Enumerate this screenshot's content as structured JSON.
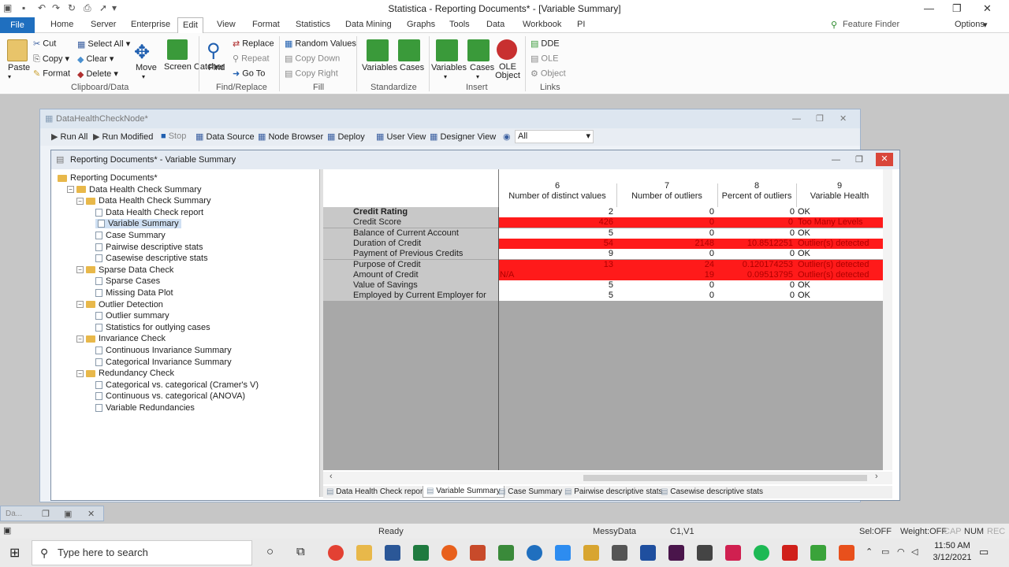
{
  "app_title": "Statistica - Reporting Documents* - [Variable Summary]",
  "menu": {
    "file": "File",
    "items": [
      "Home",
      "Server",
      "Enterprise",
      "Edit",
      "View",
      "Format",
      "Statistics",
      "Data Mining",
      "Graphs",
      "Tools",
      "Data",
      "Workbook",
      "PI"
    ],
    "feature_finder": "Feature Finder",
    "options": "Options"
  },
  "ribbon": {
    "paste": "Paste",
    "cut": "Cut",
    "copy": "Copy",
    "format": "Format",
    "select_all": "Select All",
    "clear": "Clear",
    "delete": "Delete",
    "move": "Move",
    "screen_catcher": "Screen Catcher",
    "find": "Find",
    "replace": "Replace",
    "repeat": "Repeat",
    "go_to": "Go To",
    "random_values": "Random Values",
    "copy_down": "Copy Down",
    "copy_right": "Copy Right",
    "std_variables": "Variables",
    "std_cases": "Cases",
    "ins_variables": "Variables",
    "ins_cases": "Cases",
    "ole_object": "OLE Object",
    "dde": "DDE",
    "ole": "OLE",
    "object": "Object",
    "groups": [
      "Clipboard/Data",
      "Find/Replace",
      "Fill",
      "Standardize",
      "Insert",
      "Links"
    ]
  },
  "node_window": {
    "title": "DataHealthCheckNode*",
    "toolbar": [
      "Run All",
      "Run Modified",
      "Stop",
      "Data Source",
      "Node Browser",
      "Deploy",
      "User View",
      "Designer View"
    ],
    "filter_value": "All"
  },
  "report_window": {
    "title": "Reporting Documents* - Variable Summary",
    "tree": [
      {
        "label": "Reporting Documents*",
        "level": 0,
        "type": "folder"
      },
      {
        "label": "Data Health Check Summary",
        "level": 1,
        "type": "folder"
      },
      {
        "label": "Data Health Check Summary",
        "level": 2,
        "type": "folder"
      },
      {
        "label": "Data Health Check report",
        "level": 3,
        "type": "doc"
      },
      {
        "label": "Variable Summary",
        "level": 3,
        "type": "doc",
        "selected": true
      },
      {
        "label": "Case Summary",
        "level": 3,
        "type": "doc"
      },
      {
        "label": "Pairwise descriptive stats",
        "level": 3,
        "type": "doc"
      },
      {
        "label": "Casewise descriptive stats",
        "level": 3,
        "type": "doc"
      },
      {
        "label": "Sparse Data Check",
        "level": 2,
        "type": "folder"
      },
      {
        "label": "Sparse Cases",
        "level": 3,
        "type": "doc"
      },
      {
        "label": "Missing Data Plot",
        "level": 3,
        "type": "doc"
      },
      {
        "label": "Outlier Detection",
        "level": 2,
        "type": "folder"
      },
      {
        "label": "Outlier summary",
        "level": 3,
        "type": "doc"
      },
      {
        "label": "Statistics for outlying cases",
        "level": 3,
        "type": "doc"
      },
      {
        "label": "Invariance Check",
        "level": 2,
        "type": "folder"
      },
      {
        "label": "Continuous Invariance Summary",
        "level": 3,
        "type": "doc"
      },
      {
        "label": "Categorical Invariance Summary",
        "level": 3,
        "type": "doc"
      },
      {
        "label": "Redundancy Check",
        "level": 2,
        "type": "folder"
      },
      {
        "label": "Categorical vs. categorical (Cramer's V)",
        "level": 3,
        "type": "doc"
      },
      {
        "label": "Continuous vs. categorical (ANOVA)",
        "level": 3,
        "type": "doc"
      },
      {
        "label": "Variable Redundancies",
        "level": 3,
        "type": "doc"
      }
    ],
    "columns": [
      {
        "num": "6",
        "name": "Number of distinct values"
      },
      {
        "num": "7",
        "name": "Number of outliers"
      },
      {
        "num": "8",
        "name": "Percent of outliers"
      },
      {
        "num": "9",
        "name": "Variable Health"
      }
    ],
    "rows": [
      {
        "label": "Credit Rating",
        "bold": true,
        "values": [
          "2",
          "0",
          "0",
          "OK"
        ],
        "flag": false
      },
      {
        "label": "Credit Score",
        "values": [
          "426",
          "0",
          "0",
          "Too Many Levels"
        ],
        "flag": true
      },
      {
        "label": "Balance of Current Account",
        "values": [
          "5",
          "0",
          "0",
          "OK"
        ],
        "flag": false
      },
      {
        "label": "Duration of Credit",
        "values": [
          "54",
          "2148",
          "10.8512251",
          "Outlier(s) detected"
        ],
        "flag": true
      },
      {
        "label": "Payment of Previous Credits",
        "values": [
          "9",
          "0",
          "0",
          "OK"
        ],
        "flag": false
      },
      {
        "label": "Purpose of Credit",
        "values": [
          "13",
          "24",
          "0.120174253",
          "Outlier(s) detected"
        ],
        "flag": true
      },
      {
        "label": "Amount of Credit",
        "values": [
          "N/A",
          "19",
          "0.09513795",
          "Outlier(s) detected"
        ],
        "flag": true
      },
      {
        "label": "Value of Savings",
        "values": [
          "5",
          "0",
          "0",
          "OK"
        ],
        "flag": false
      },
      {
        "label": "Employed by Current Employer for",
        "values": [
          "5",
          "0",
          "0",
          "OK"
        ],
        "flag": false
      }
    ],
    "sheet_tabs": [
      "Data Health Check report",
      "Variable Summary",
      "Case Summary",
      "Pairwise descriptive stats",
      "Casewise descriptive stats"
    ],
    "active_tab": "Variable Summary"
  },
  "minimized": "Da...",
  "status_bar": {
    "ready": "Ready",
    "dataset": "MessyData",
    "cell": "C1,V1",
    "sel": "Sel:OFF",
    "weight": "Weight:OFF",
    "cap": "CAP",
    "num": "NUM",
    "rec": "REC"
  },
  "taskbar": {
    "search_placeholder": "Type here to search",
    "time": "11:50 AM",
    "date": "3/12/2021"
  },
  "colors": {
    "flag_red": "#ff1a1a",
    "accent_blue": "#1f6fbf"
  }
}
